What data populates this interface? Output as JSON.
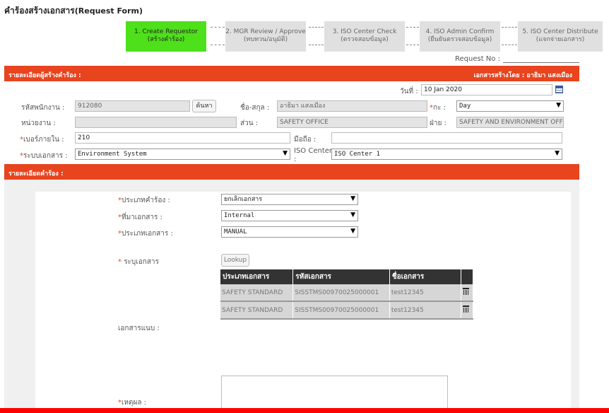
{
  "title": "คำร้องสร้างเอกสาร",
  "title_sub": "(Request Form)",
  "steps": [
    {
      "line1": "1. Create Requestor",
      "line2": "(สร้างคำร้อง)"
    },
    {
      "line1": "2. MGR Review / Approve",
      "line2": "(ทบทวน/อนุมัติ)"
    },
    {
      "line1": "3. ISO Center Check",
      "line2": "(ตรวจสอบข้อมูล)"
    },
    {
      "line1": "4. ISO Admin Confirm",
      "line2": "(ยืนยันตรวจสอบข้อมูล)"
    },
    {
      "line1": "5. ISO Center Distribute",
      "line2": "(แจกจ่ายเอกสาร)"
    }
  ],
  "request_no_label": "Request No :",
  "section1": {
    "title": "รายละเอียดผู้สร้างคำร้อง :",
    "created_by": "เอกสารสร้างโดย : อาธิมา แสงเมือง"
  },
  "form": {
    "date_label": "วันที่ :",
    "date_value": "10 Jan 2020",
    "emp_code_label": "รหัสพนักงาน :",
    "emp_code_value": "912080",
    "search_btn": "ค้นหา",
    "name_label": "ชื่อ-สกุล :",
    "name_value": "อาธิมา แสงเมือง",
    "shift_label": "กะ :",
    "shift_value": "Day",
    "unit_label": "หน่วยงาน :",
    "unit_value": "",
    "section_label": "ส่วน :",
    "section_value": "SAFETY OFFICE",
    "dept_label": "ฝ่าย :",
    "dept_value": "SAFETY AND ENVIRONMENT OFFICE",
    "ext_label": "เบอร์ภายใน :",
    "ext_value": "210",
    "mobile_label": "มือถือ :",
    "mobile_value": "",
    "system_label": "ระบบเอกสาร :",
    "system_value": "Environment System",
    "iso_center_label": "ISO Center",
    "iso_center_colon": ":",
    "iso_center_value": "ISO Center 1"
  },
  "section2": {
    "title": "รายละเอียดคำร้อง :"
  },
  "request": {
    "type_label": "ประเภทคำร้อง :",
    "type_value": "ยกเลิกเอกสาร",
    "origin_label": "ที่มาเอกสาร :",
    "origin_value": "Internal",
    "doctype_label": "ประเภทเอกสาร :",
    "doctype_value": "MANUAL",
    "specify_label": "ระบุเอกสาร",
    "lookup_btn": "Lookup",
    "attach_label": "เอกสารแนบ :",
    "reason_label": "เหตุผล :"
  },
  "docs_table": {
    "headers": [
      "ประเภทเอกสาร",
      "รหัสเอกสาร",
      "ชื่อเอกสาร",
      ""
    ],
    "rows": [
      [
        "SAFETY STANDARD",
        "SISSTMS00970025000001",
        "test12345"
      ],
      [
        "SAFETY STANDARD",
        "SISSTMS00970025000001",
        "test12345"
      ]
    ]
  },
  "colors": {
    "accent": "#e8441e",
    "active_step": "#4ee01a",
    "bottom_bar": "#ff0000"
  },
  "icons": {
    "calendar": "calendar-icon",
    "delete": "trash-icon",
    "dropdown": "chevron-down-icon"
  }
}
